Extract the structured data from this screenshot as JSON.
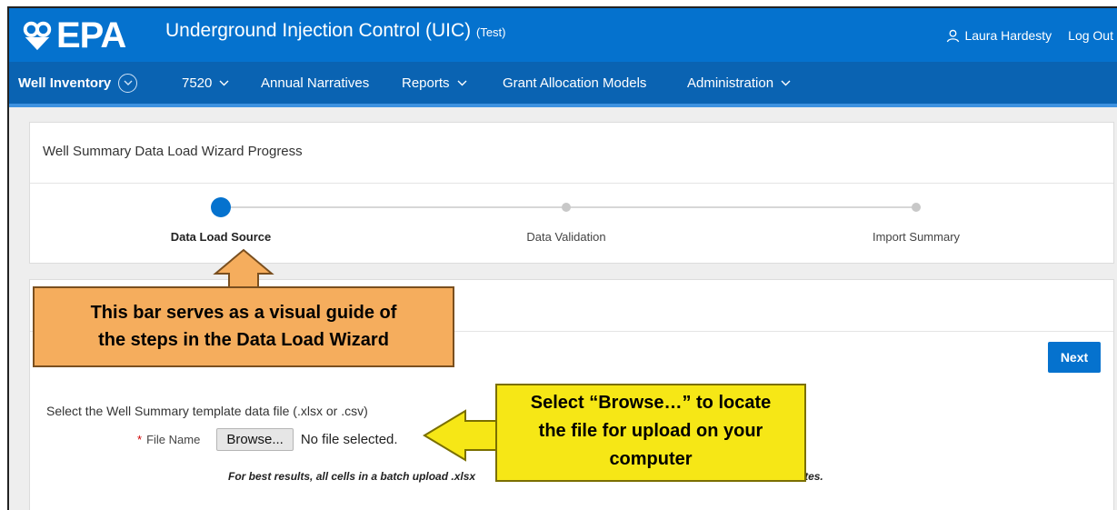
{
  "header": {
    "logo_text": "EPA",
    "app_title": "Underground Injection Control (UIC)",
    "env_label": "(Test)",
    "user_name": "Laura Hardesty",
    "logout_label": "Log Out",
    "bar_color": "#0572ce"
  },
  "nav": {
    "items": [
      {
        "label": "Well Inventory"
      },
      {
        "label": "7520"
      },
      {
        "label": "Annual Narratives"
      },
      {
        "label": "Reports"
      },
      {
        "label": "Grant Allocation Models"
      },
      {
        "label": "Administration"
      }
    ]
  },
  "progress": {
    "title": "Well Summary Data Load Wizard Progress",
    "steps": [
      {
        "label": "Data Load Source",
        "active": true
      },
      {
        "label": "Data Validation",
        "active": false
      },
      {
        "label": "Import Summary",
        "active": false
      }
    ]
  },
  "upload": {
    "next_label": "Next",
    "prompt": "Select the Well Summary template data file (.xlsx or .csv)",
    "field_label": "File Name",
    "required_mark": "*",
    "browse_label": "Browse...",
    "file_status": "No file selected.",
    "tip_left": "For best results, all cells in a batch upload .xlsx",
    "tip_right": "nd dates."
  },
  "callouts": {
    "progress_line1": "This bar serves as a visual guide of",
    "progress_line2": "the steps in the Data Load Wizard",
    "browse_line1": "Select “Browse…” to locate",
    "browse_line2": "the file for upload on your",
    "browse_line3": "computer",
    "progress_color": "#f5ad5d",
    "browse_color": "#f6e716"
  }
}
